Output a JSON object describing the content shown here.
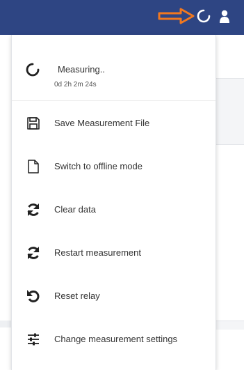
{
  "header": {
    "icons": [
      "arrow-right-icon",
      "spinner-icon",
      "user-icon"
    ],
    "accent_color": "#2e4583",
    "arrow_color": "#f07820"
  },
  "menu": {
    "status": {
      "label": "Measuring..",
      "elapsed": "0d 2h 2m 24s",
      "icon": "spinner-icon"
    },
    "items": [
      {
        "label": "Save Measurement File",
        "icon": "save-icon"
      },
      {
        "label": "Switch to offline mode",
        "icon": "file-icon"
      },
      {
        "label": "Clear data",
        "icon": "refresh-icon"
      },
      {
        "label": "Restart measurement",
        "icon": "refresh-icon"
      },
      {
        "label": "Reset relay",
        "icon": "undo-icon"
      },
      {
        "label": "Change measurement settings",
        "icon": "sliders-icon"
      }
    ]
  }
}
